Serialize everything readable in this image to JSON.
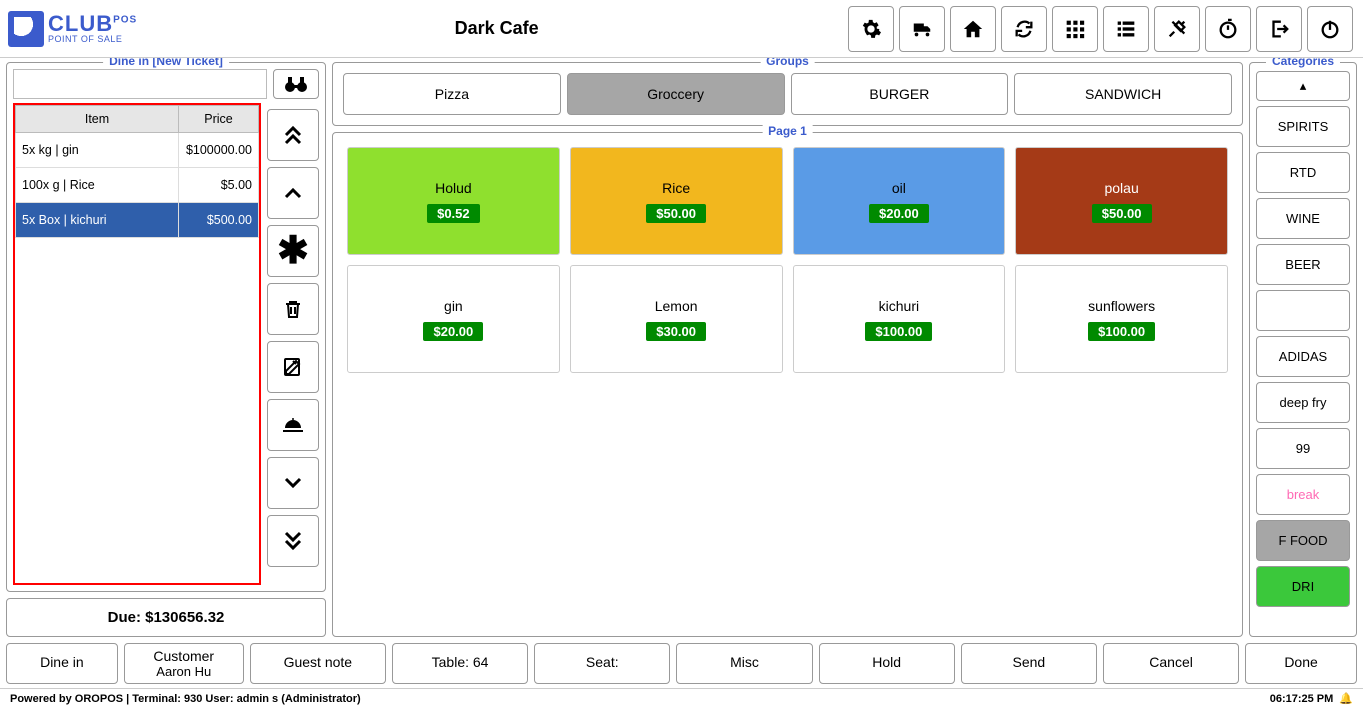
{
  "app": {
    "title": "Dark Cafe",
    "logo_main": "CLUB",
    "logo_suffix": "POS",
    "logo_sub": "POINT OF SALE"
  },
  "ticket": {
    "panel_label": "Dine in [New Ticket]",
    "search_value": "",
    "headers": {
      "item": "Item",
      "price": "Price"
    },
    "rows": [
      {
        "item": "5x kg | gin",
        "price": "$100000.00",
        "selected": false
      },
      {
        "item": "100x g | Rice",
        "price": "$5.00",
        "selected": false
      },
      {
        "item": "5x Box | kichuri",
        "price": "$500.00",
        "selected": true
      }
    ],
    "due_label": "Due: $130656.32"
  },
  "groups": {
    "panel_label": "Groups",
    "items": [
      {
        "label": "Pizza",
        "active": false
      },
      {
        "label": "Groccery",
        "active": true
      },
      {
        "label": "BURGER",
        "active": false
      },
      {
        "label": "SANDWICH",
        "active": false
      }
    ]
  },
  "page": {
    "panel_label": "Page 1",
    "products": [
      {
        "name": "Holud",
        "price": "$0.52",
        "bg": "#8fe02e",
        "fg": "#000"
      },
      {
        "name": "Rice",
        "price": "$50.00",
        "bg": "#f2b71e",
        "fg": "#000"
      },
      {
        "name": "oil",
        "price": "$20.00",
        "bg": "#5a9be6",
        "fg": "#000"
      },
      {
        "name": "polau",
        "price": "$50.00",
        "bg": "#a53a17",
        "fg": "#fff"
      },
      {
        "name": "gin",
        "price": "$20.00",
        "bg": "#fff",
        "fg": "#000"
      },
      {
        "name": "Lemon",
        "price": "$30.00",
        "bg": "#fff",
        "fg": "#000"
      },
      {
        "name": "kichuri",
        "price": "$100.00",
        "bg": "#fff",
        "fg": "#000"
      },
      {
        "name": "sunflowers",
        "price": "$100.00",
        "bg": "#fff",
        "fg": "#000"
      }
    ]
  },
  "categories": {
    "panel_label": "Categories",
    "items": [
      {
        "label": "SPIRITS",
        "cls": ""
      },
      {
        "label": "RTD",
        "cls": ""
      },
      {
        "label": "WINE",
        "cls": ""
      },
      {
        "label": "BEER",
        "cls": ""
      },
      {
        "label": "",
        "cls": ""
      },
      {
        "label": "ADIDAS",
        "cls": ""
      },
      {
        "label": "deep fry",
        "cls": ""
      },
      {
        "label": "99",
        "cls": ""
      },
      {
        "label": "break",
        "cls": "break"
      },
      {
        "label": "F FOOD",
        "cls": "ffood"
      },
      {
        "label": "DRI",
        "cls": "dri"
      }
    ]
  },
  "actions": {
    "dinein": "Dine in",
    "customer": "Customer",
    "customer_name": "Aaron Hu",
    "guest_note": "Guest note",
    "table": "Table: 64",
    "seat": "Seat:",
    "misc": "Misc",
    "hold": "Hold",
    "send": "Send",
    "cancel": "Cancel",
    "done": "Done"
  },
  "status": {
    "text": "Powered by OROPOS  |  Terminal: 930  User: admin s (Administrator)",
    "clock": "06:17:25 PM"
  }
}
